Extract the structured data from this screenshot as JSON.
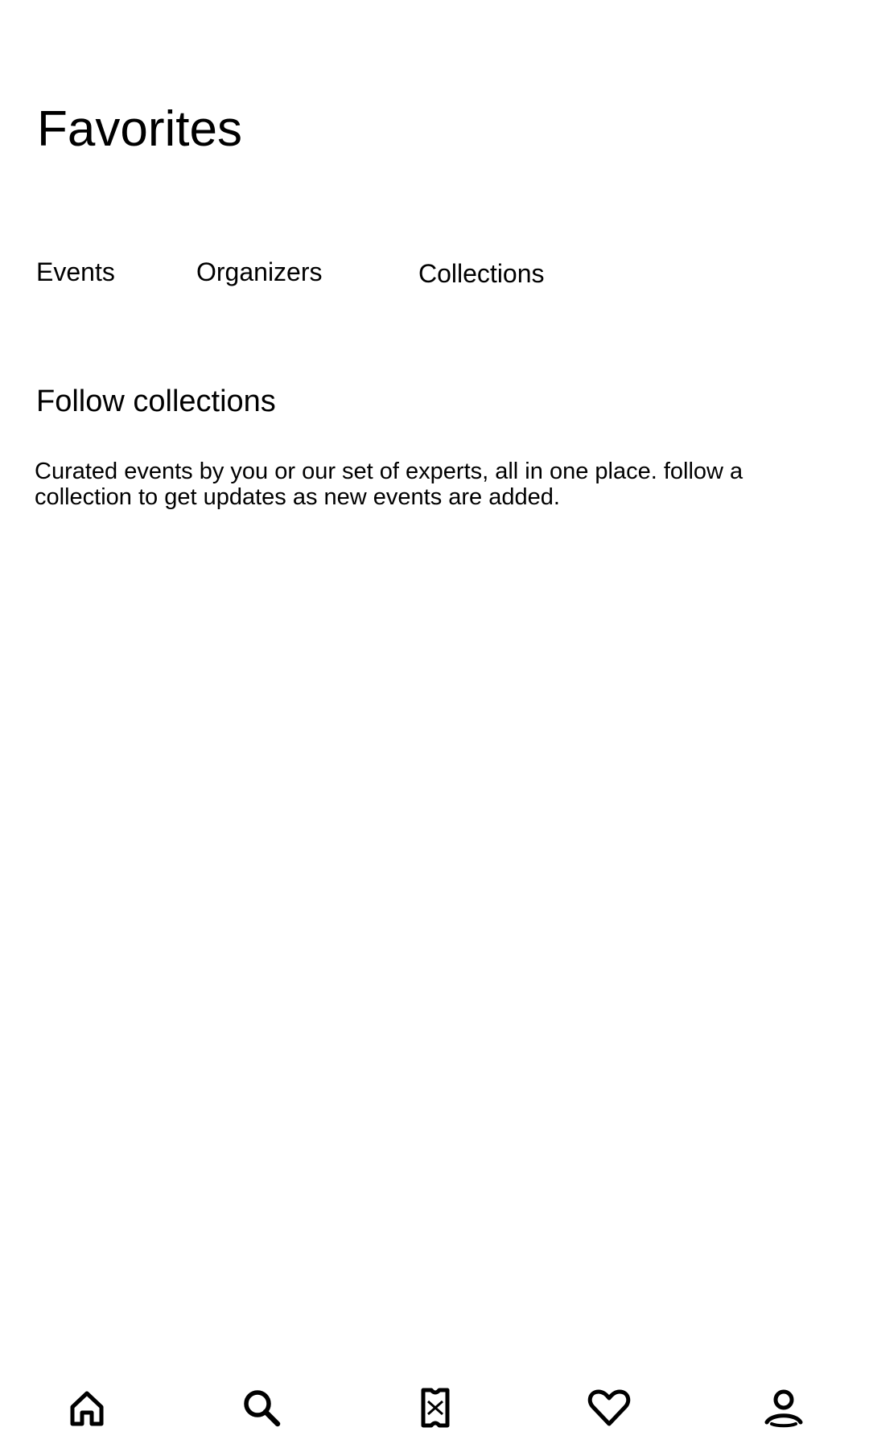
{
  "page": {
    "title": "Favorites"
  },
  "tabs": [
    {
      "label": "Events"
    },
    {
      "label": "Organizers"
    },
    {
      "label": "Collections"
    }
  ],
  "collections": {
    "heading": "Follow collections",
    "description": "Curated events by you or our set of experts, all in one place. follow a collection to get updates as new events are added."
  },
  "bottom_nav": {
    "items": [
      {
        "icon": "home-icon"
      },
      {
        "icon": "search-icon"
      },
      {
        "icon": "ticket-icon"
      },
      {
        "icon": "heart-icon"
      },
      {
        "icon": "profile-icon"
      }
    ]
  }
}
